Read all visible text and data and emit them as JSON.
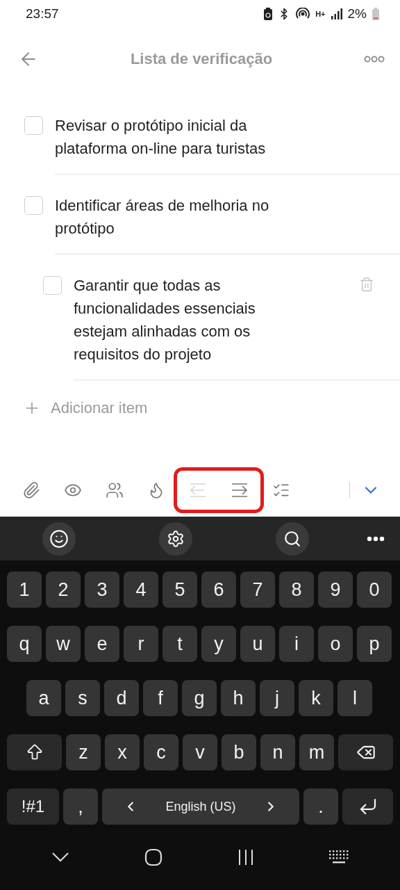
{
  "status_bar": {
    "time": "23:57",
    "network": "H+",
    "battery": "2%"
  },
  "header": {
    "title": "Lista de verificação"
  },
  "checklist": [
    {
      "text": "Revisar o protótipo inicial da plataforma on-line para turistas",
      "checked": false,
      "focused": false
    },
    {
      "text": "Identificar áreas de melhoria no protótipo",
      "checked": false,
      "focused": false,
      "children": [
        {
          "text": "Garantir que todas as funcionalidades essenciais estejam alinhadas com os requisitos do projeto",
          "checked": false,
          "focused": true
        }
      ]
    }
  ],
  "add_item": {
    "label": "Adicionar item"
  },
  "toolbar": {
    "tools": [
      {
        "kind": "attach",
        "disabled": false,
        "highlighted": false
      },
      {
        "kind": "visibility",
        "disabled": false,
        "highlighted": false
      },
      {
        "kind": "people",
        "disabled": false,
        "highlighted": false
      },
      {
        "kind": "priority",
        "disabled": false,
        "highlighted": false
      },
      {
        "kind": "outdent",
        "disabled": true,
        "highlighted": true
      },
      {
        "kind": "indent",
        "disabled": false,
        "highlighted": true
      },
      {
        "kind": "convert",
        "disabled": false,
        "highlighted": false
      }
    ]
  },
  "keyboard": {
    "rows": [
      {
        "keys": [
          {
            "kind": "char",
            "label": "1"
          },
          {
            "kind": "char",
            "label": "2"
          },
          {
            "kind": "char",
            "label": "3"
          },
          {
            "kind": "char",
            "label": "4"
          },
          {
            "kind": "char",
            "label": "5"
          },
          {
            "kind": "char",
            "label": "6"
          },
          {
            "kind": "char",
            "label": "7"
          },
          {
            "kind": "char",
            "label": "8"
          },
          {
            "kind": "char",
            "label": "9"
          },
          {
            "kind": "char",
            "label": "0"
          }
        ]
      },
      {
        "keys": [
          {
            "kind": "char",
            "label": "q"
          },
          {
            "kind": "char",
            "label": "w"
          },
          {
            "kind": "char",
            "label": "e"
          },
          {
            "kind": "char",
            "label": "r"
          },
          {
            "kind": "char",
            "label": "t"
          },
          {
            "kind": "char",
            "label": "y"
          },
          {
            "kind": "char",
            "label": "u"
          },
          {
            "kind": "char",
            "label": "i"
          },
          {
            "kind": "char",
            "label": "o"
          },
          {
            "kind": "char",
            "label": "p"
          }
        ]
      },
      {
        "keys": [
          {
            "kind": "char",
            "label": "a"
          },
          {
            "kind": "char",
            "label": "s"
          },
          {
            "kind": "char",
            "label": "d"
          },
          {
            "kind": "char",
            "label": "f"
          },
          {
            "kind": "char",
            "label": "g"
          },
          {
            "kind": "char",
            "label": "h"
          },
          {
            "kind": "char",
            "label": "j"
          },
          {
            "kind": "char",
            "label": "k"
          },
          {
            "kind": "char",
            "label": "l"
          }
        ]
      },
      {
        "keys": [
          {
            "kind": "shift"
          },
          {
            "kind": "char",
            "label": "z"
          },
          {
            "kind": "char",
            "label": "x"
          },
          {
            "kind": "char",
            "label": "c"
          },
          {
            "kind": "char",
            "label": "v"
          },
          {
            "kind": "char",
            "label": "b"
          },
          {
            "kind": "char",
            "label": "n"
          },
          {
            "kind": "char",
            "label": "m"
          },
          {
            "kind": "backspace"
          }
        ]
      },
      {
        "keys": [
          {
            "kind": "symbols",
            "label": "!#1"
          },
          {
            "kind": "char",
            "label": ","
          },
          {
            "kind": "space",
            "label": "English (US)"
          },
          {
            "kind": "char",
            "label": "."
          },
          {
            "kind": "enter"
          }
        ]
      }
    ]
  }
}
